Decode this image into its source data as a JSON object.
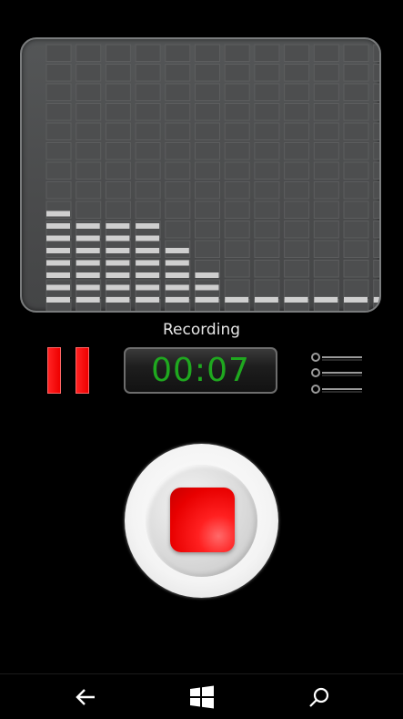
{
  "status": {
    "label": "Recording"
  },
  "timer": {
    "value": "00:07"
  },
  "level_meter": {
    "columns": 12,
    "rows": 14,
    "lit_per_column": [
      8,
      7,
      7,
      7,
      5,
      3,
      1,
      1,
      1,
      1,
      1,
      1
    ]
  },
  "colors": {
    "pause": "#ff1a1a",
    "record": "#f01010",
    "timer_text": "#1fa81f"
  },
  "icons": {
    "pause": "pause-icon",
    "list": "list-icon",
    "record": "stop-icon",
    "back": "back-arrow-icon",
    "windows": "windows-logo-icon",
    "search": "search-icon"
  }
}
